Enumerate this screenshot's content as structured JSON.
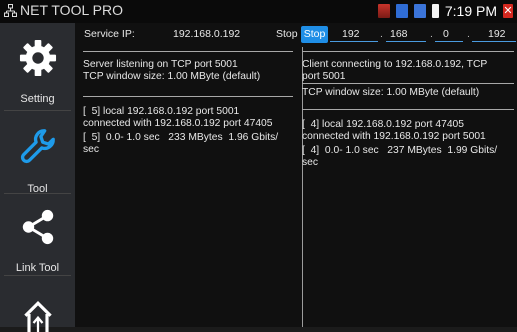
{
  "status_bar": {
    "app_title": "NET TOOL PRO",
    "time": "7:19 PM"
  },
  "sidebar": {
    "items": [
      {
        "label": "Setting",
        "icon": "gear-icon"
      },
      {
        "label": "Tool",
        "icon": "wrench-icon"
      },
      {
        "label": "Link Tool",
        "icon": "share-icon"
      },
      {
        "label": "",
        "icon": "upload-icon"
      }
    ]
  },
  "header": {
    "service_ip_label": "Service IP:",
    "service_ip_value": "192.168.0.192",
    "server_stop_label": "Stop",
    "client_stop_label": "Stop",
    "client_ip": [
      "192",
      "168",
      "0",
      "192"
    ]
  },
  "server_log": [
    "Server listening on TCP port 5001",
    "TCP window size: 1.00 MByte (default)",
    "[  5] local 192.168.0.192 port 5001",
    "connected with 192.168.0.192 port 47405",
    "[  5]  0.0- 1.0 sec   233 MBytes  1.96 Gbits/",
    "sec"
  ],
  "client_log": [
    "Client connecting to 192.168.0.192, TCP",
    "port 5001",
    "TCP window size: 1.00 MByte (default)",
    "[  4] local 192.168.0.192 port 47405",
    "connected with 192.168.0.192 port 5001",
    "[  4]  0.0- 1.0 sec   237 MBytes  1.99 Gbits/",
    "sec"
  ],
  "colors": {
    "accent": "#1f8ee6",
    "sidebar_bg": "#2a2c30",
    "content_bg": "#101010"
  }
}
